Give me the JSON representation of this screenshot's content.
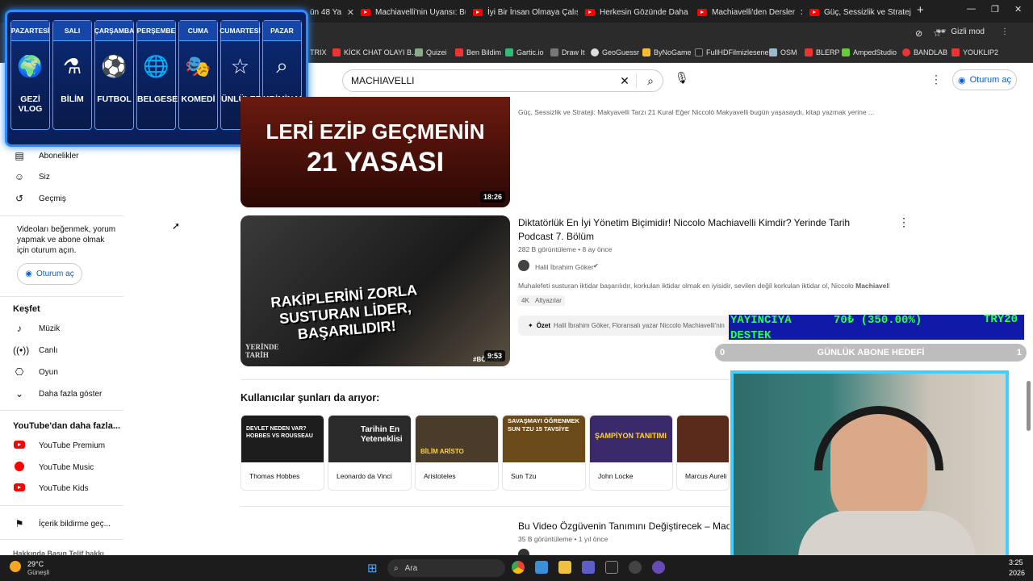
{
  "browser": {
    "tabs": [
      {
        "label": "ün 48 Ya"
      },
      {
        "label": "Machiavelli'nin Uyansı: Bu"
      },
      {
        "label": "İyi Bir İnsan Olmaya Çalış"
      },
      {
        "label": "Herkesin Gözünde Daha"
      },
      {
        "label": "Machiavelli'den Dersler"
      },
      {
        "label": "Güç, Sessizlik ve Strateji:"
      }
    ],
    "new_tab": "+",
    "incognito": "Gizli mod",
    "bookmarks": [
      "TRIX",
      "KİCK CHAT OLAYI B...",
      "Quizei",
      "Ben Bildim",
      "Gartic.io",
      "Draw It",
      "GeoGuessr",
      "ByNoGame",
      "FullHDFilmizlesene",
      "OSM",
      "BLERP",
      "AmpedStudio",
      "BANDLAB",
      "YOUKLIP2"
    ]
  },
  "header": {
    "search_value": "MACHIAVELLI",
    "signin": "Oturum aç"
  },
  "sidebar": {
    "items_top": [
      {
        "label": "Abonelikler"
      },
      {
        "label": "Siz"
      },
      {
        "label": "Geçmiş"
      }
    ],
    "signin_prompt": "Videoları beğenmek, yorum yapmak ve abone olmak için oturum açın.",
    "signin": "Oturum aç",
    "explore_title": "Keşfet",
    "explore": [
      {
        "label": "Müzik"
      },
      {
        "label": "Canlı"
      },
      {
        "label": "Oyun"
      },
      {
        "label": "Daha fazla göster"
      }
    ],
    "more_title": "YouTube'dan daha fazla...",
    "more": [
      {
        "label": "YouTube Premium"
      },
      {
        "label": "YouTube Music"
      },
      {
        "label": "YouTube Kids"
      }
    ],
    "report": "İçerik bildirme geç...",
    "footer": "Hakkında  Basın  Telif hakkı"
  },
  "schedule": {
    "days": [
      {
        "day": "PAZARTESİ",
        "category": "GEZİ VLOG",
        "icon": "globe-plane-icon"
      },
      {
        "day": "SALI",
        "category": "BİLİM",
        "icon": "microscope-icon"
      },
      {
        "day": "ÇARŞAMBA",
        "category": "FUTBOL",
        "icon": "soccer-ball-icon"
      },
      {
        "day": "PERŞEMBE",
        "category": "BELGESEL",
        "icon": "globe-icon"
      },
      {
        "day": "CUMA",
        "category": "KOMEDİ",
        "icon": "comedy-mask-icon"
      },
      {
        "day": "CUMARTESİ",
        "category": "ÜNLÜLER",
        "icon": "star-icon"
      },
      {
        "day": "PAZAR",
        "category": "KRİMİNAL",
        "icon": "fingerprint-icon"
      }
    ]
  },
  "results": [
    {
      "thumb_text_1": "LERİ EZİP GEÇMENİN",
      "thumb_text_2": "21 YASASI",
      "duration": "18:26",
      "description": "Güç, Sessizlik ve Strateji: Makyavelli Tarzı 21 Kural Eğer Niccolò Makyavelli bugün yaşasaydı, kitap yazmak yerine ..."
    },
    {
      "title": "Diktatörlük En İyi Yönetim Biçimidir! Niccolo Machiavelli Kimdir? Yerinde Tarih Podcast 7. Bölüm",
      "meta": "282 B görüntüleme • 8 ay önce",
      "channel": "Halil İbrahim Göker",
      "description_prefix": "Muhalefeti susturan iktidar başarılıdır, korkulan iktidar olmak en iyisidir, sevilen değil korkulan iktidar ol, Niccolo ",
      "description_bold": "Machiavelli",
      "description_suffix": " ...",
      "chips": [
        "4K",
        "Altyazılar"
      ],
      "thumb_text": "RAKİPLERİNİ ZORLA SUSTURAN LİDER, BAŞARILIDIR!",
      "thumb_brand": "YERİNDE TARİH",
      "thumb_tag": "#BÖLÜM",
      "duration": "9:53",
      "summary_label": "Özet",
      "summary_text": "Halil İbrahim Göker, Floransalı yazar Niccolo Machiavelli'nin"
    },
    {
      "title": "Bu Video Özgüvenin Tanımını Değiştirecek – Mac",
      "meta": "35 B görüntüleme • 1 yıl önce"
    }
  ],
  "also_searched": {
    "title": "Kullanıcılar şunları da arıyor:",
    "cards": [
      {
        "label": "Thomas Hobbes",
        "thumb": "DEVLET NEDEN VAR? HOBBES VS ROUSSEAU",
        "color": "#1d1d1d"
      },
      {
        "label": "Leonardo da Vinci",
        "thumb": "Tarihin En Yeteneklisi",
        "color": "#2a2a2a"
      },
      {
        "label": "Aristoteles",
        "thumb": "BİLİM ARİSTO",
        "color": "#4a3b2a"
      },
      {
        "label": "Sun Tzu",
        "thumb": "SAVAŞMAYI ÖĞRENMEK SUN TZU 15 TAVSİYE",
        "color": "#6b4a1a"
      },
      {
        "label": "John Locke",
        "thumb": "ŞAMPİYON TANITIMI",
        "color": "#3b2a6b"
      },
      {
        "label": "Marcus Aureli",
        "thumb": "",
        "color": "#5a2a1a"
      }
    ]
  },
  "stream": {
    "donate_label": "YAYINCIYA DESTEK",
    "donate_amount": "70₺ (350.00%)",
    "donate_currency": "TRY20",
    "goal_min": "0",
    "goal_label": "GÜNLÜK ABONE HEDEFİ",
    "goal_max": "1"
  },
  "taskbar": {
    "weather_temp": "29°C",
    "weather_desc": "Güneşli",
    "search_placeholder": "Ara",
    "time": "3:25",
    "date": "2026"
  },
  "colors": {
    "accent": "#065fd4",
    "youtube_red": "#ff0000",
    "overlay_border": "#2a8cff",
    "cam_border": "#3fd0ff"
  }
}
